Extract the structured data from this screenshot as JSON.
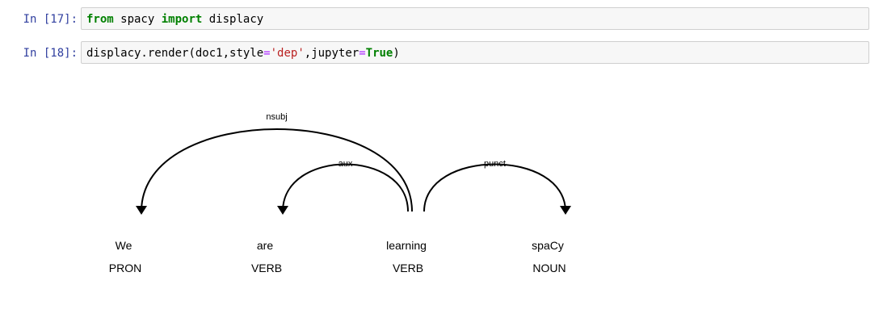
{
  "cells": [
    {
      "prompt": "In [17]:",
      "tokens": [
        {
          "text": "from",
          "kind": "kw"
        },
        {
          "text": " spacy ",
          "kind": "plain"
        },
        {
          "text": "import",
          "kind": "kw"
        },
        {
          "text": " displacy",
          "kind": "plain"
        }
      ]
    },
    {
      "prompt": "In [18]:",
      "tokens": [
        {
          "text": "displacy.render",
          "kind": "plain"
        },
        {
          "text": "(",
          "kind": "paren"
        },
        {
          "text": "doc1,style",
          "kind": "plain"
        },
        {
          "text": "=",
          "kind": "op"
        },
        {
          "text": "'dep'",
          "kind": "str"
        },
        {
          "text": ",jupyter",
          "kind": "plain"
        },
        {
          "text": "=",
          "kind": "op"
        },
        {
          "text": "True",
          "kind": "kw"
        },
        {
          "text": ")",
          "kind": "paren"
        }
      ]
    }
  ],
  "dependency": {
    "words": [
      {
        "text": "We",
        "tag": "PRON"
      },
      {
        "text": "are",
        "tag": "VERB"
      },
      {
        "text": "learning",
        "tag": "VERB"
      },
      {
        "text": "spaCy",
        "tag": "NOUN"
      }
    ],
    "arcs": [
      {
        "label": "nsubj",
        "head": 2,
        "dep": 0
      },
      {
        "label": "aux",
        "head": 2,
        "dep": 1
      },
      {
        "label": "punct",
        "head": 2,
        "dep": 3
      }
    ]
  }
}
